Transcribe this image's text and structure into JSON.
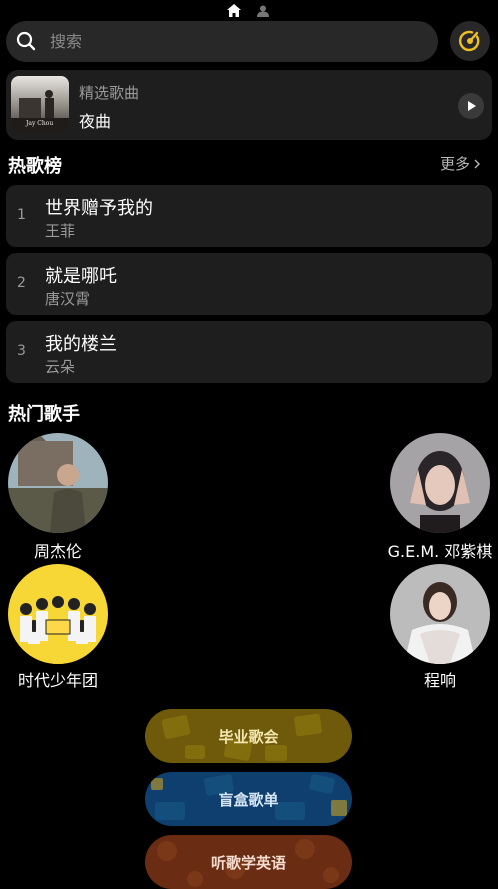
{
  "topnav": {
    "home_icon": "home-icon",
    "profile_icon": "person-icon"
  },
  "search": {
    "placeholder": "搜索",
    "value": ""
  },
  "featured": {
    "subtitle": "精选歌曲",
    "title": "夜曲",
    "cover_text": "Jay Chou"
  },
  "hot_songs": {
    "title": "热歌榜",
    "more": "更多",
    "items": [
      {
        "rank": "1",
        "title": "世界赠予我的",
        "artist": "王菲"
      },
      {
        "rank": "2",
        "title": "就是哪吒",
        "artist": "唐汉霄"
      },
      {
        "rank": "3",
        "title": "我的楼兰",
        "artist": "云朵"
      }
    ]
  },
  "hot_artists": {
    "title": "热门歌手",
    "items": [
      {
        "name": "周杰伦"
      },
      {
        "name": "G.E.M. 邓紫棋"
      },
      {
        "name": "时代少年团"
      },
      {
        "name": "程响"
      }
    ]
  },
  "playlists": {
    "items": [
      {
        "label": "毕业歌会",
        "color": "#6e5a0a"
      },
      {
        "label": "盲盒歌单",
        "color": "#0e3f6e"
      },
      {
        "label": "听歌学英语",
        "color": "#6a2c12"
      }
    ]
  },
  "colors": {
    "accent": "#f0c020",
    "background": "#000000",
    "card": "#1e1e1e"
  }
}
